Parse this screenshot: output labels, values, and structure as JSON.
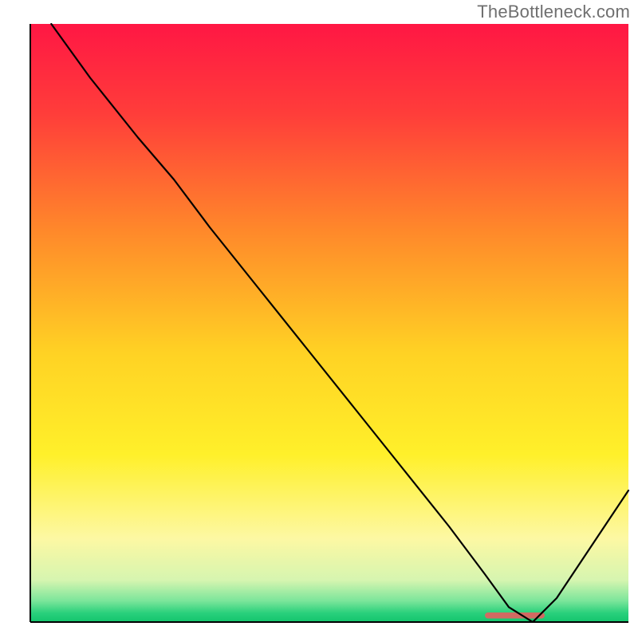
{
  "watermark": "TheBottleneck.com",
  "chart_data": {
    "type": "line",
    "title": "",
    "xlabel": "",
    "ylabel": "",
    "xlim": [
      0,
      100
    ],
    "ylim": [
      0,
      100
    ],
    "grid": false,
    "legend": false,
    "background_gradient_stops": [
      {
        "offset": 0.0,
        "color": "#ff1744"
      },
      {
        "offset": 0.15,
        "color": "#ff3d3a"
      },
      {
        "offset": 0.35,
        "color": "#ff8a2a"
      },
      {
        "offset": 0.55,
        "color": "#ffd224"
      },
      {
        "offset": 0.72,
        "color": "#fff02a"
      },
      {
        "offset": 0.86,
        "color": "#fdf8a3"
      },
      {
        "offset": 0.93,
        "color": "#d6f5b0"
      },
      {
        "offset": 0.965,
        "color": "#7ae59a"
      },
      {
        "offset": 0.985,
        "color": "#29d07c"
      },
      {
        "offset": 1.0,
        "color": "#14c46d"
      }
    ],
    "series": [
      {
        "name": "bottleneck-curve",
        "stroke": "#000000",
        "stroke_width": 2.2,
        "x": [
          3.5,
          10,
          18,
          24,
          30,
          38,
          46,
          54,
          62,
          70,
          76,
          80,
          84,
          88,
          100
        ],
        "y": [
          100,
          91,
          81,
          74,
          66,
          56,
          46,
          36,
          26,
          16,
          8,
          2.5,
          0,
          4,
          22
        ]
      }
    ],
    "marker": {
      "name": "optimal-range-marker",
      "color": "#d16a62",
      "x_start": 76,
      "x_end": 86,
      "y": 0.6,
      "height": 1.0
    }
  }
}
